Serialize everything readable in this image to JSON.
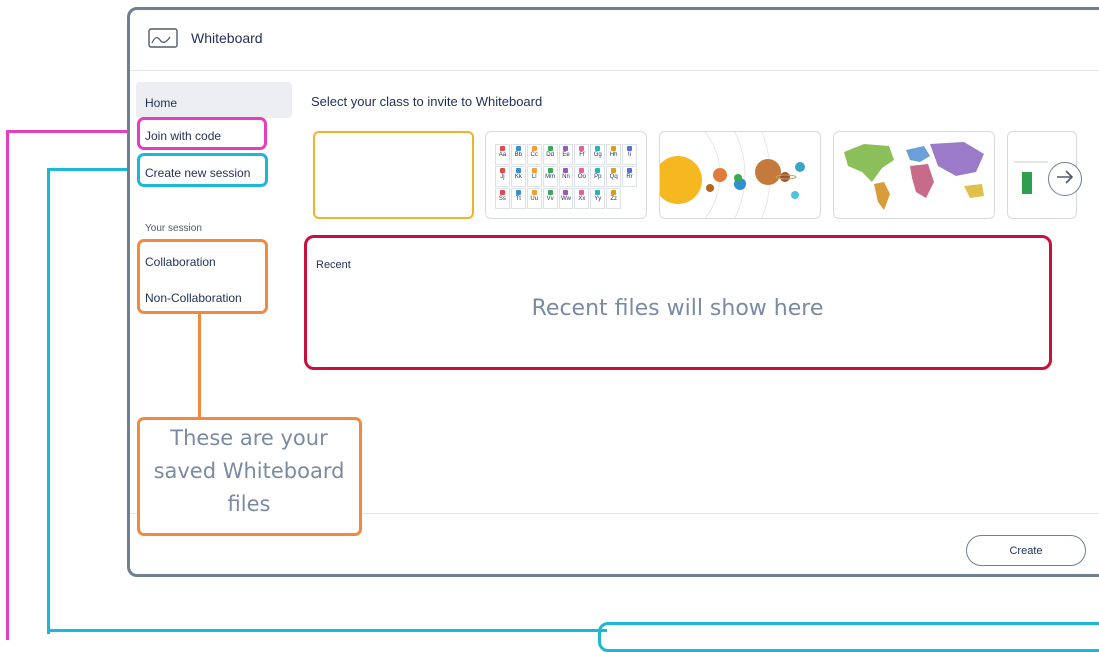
{
  "app": {
    "title": "Whiteboard"
  },
  "sidebar": {
    "items": [
      {
        "label": "Home"
      },
      {
        "label": "Join with code"
      },
      {
        "label": "Create new session"
      }
    ],
    "section_label": "Your session",
    "session_items": [
      {
        "label": "Collaboration"
      },
      {
        "label": "Non-Collaboration"
      }
    ]
  },
  "main": {
    "heading": "Select your class to invite to Whiteboard",
    "templates": [
      "blank",
      "alphabet-chart",
      "solar-system",
      "world-map",
      "partial-template"
    ],
    "alphabet": [
      "Aa",
      "Bb",
      "Cc",
      "Dd",
      "Ee",
      "Ff",
      "Gg",
      "Hh",
      "Ii",
      "Jj",
      "Kk",
      "Ll",
      "Mm",
      "Nn",
      "Oo",
      "Pp",
      "Qq",
      "Rr",
      "Ss",
      "Tt",
      "Uu",
      "Vv",
      "Ww",
      "Xx",
      "Yy",
      "Zz"
    ],
    "recent_label": "Recent",
    "create_label": "Create"
  },
  "annotations": {
    "recent_empty": "Recent files will show here",
    "saved_files_note": "These are your saved Whiteboard files"
  },
  "colors": {
    "pink": "#e43fc0",
    "cyan": "#1cb8d8",
    "orange": "#f08a3e",
    "red": "#c8103f",
    "selected_border": "#f0b429"
  }
}
